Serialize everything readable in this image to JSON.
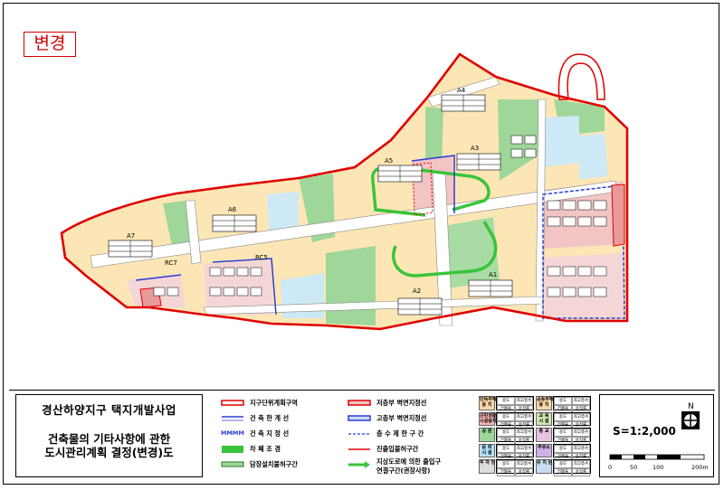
{
  "badge": "변경",
  "title_box": {
    "line1": "경산하양지구 택지개발사업",
    "line2": "건축물의 기타사항에 관한",
    "line3": "도시관리계획 결정(변경)도"
  },
  "blocks": {
    "a1": "A1",
    "a2": "A2",
    "a3": "A3",
    "a4": "A4",
    "a5": "A5",
    "a6": "A6",
    "a7": "A7",
    "rc5": "RC5",
    "rc7": "RC7"
  },
  "legend": {
    "col1": [
      "지구단위계획구역",
      "건 축 한 계 선",
      "건 축 지 정 선",
      "차 폐 조 경",
      "담장설치불허구간"
    ],
    "col2": [
      "저층부 벽면지정선",
      "고층부 벽면지정선",
      "층 수 제 한 구 간",
      "진출입불허구간",
      "지상도로에 의한 출입구",
      "연결구간(권장사항)"
    ],
    "mmm_label": "MMMM",
    "zones": [
      {
        "name": "단독주택\n용 지",
        "color": "#ffd8a8"
      },
      {
        "name": "공동주택\n용 지",
        "color": "#ffd8a8"
      },
      {
        "name": "근린생활\n시설용지",
        "color": "#f7b8b8"
      },
      {
        "name": "교 육\n시 설",
        "color": "#cfe8b0"
      },
      {
        "name": "공 원",
        "color": "#9fd69a"
      },
      {
        "name": "종 교",
        "color": "#e8c3e0"
      },
      {
        "name": "문 화\n시 설",
        "color": "#b5e0f5"
      },
      {
        "name": "주유소",
        "color": "#ccb3e8"
      },
      {
        "name": "주 차 장",
        "color": "#dcdcdc"
      },
      {
        "name": "유 치 원",
        "color": "#c8ddf2"
      }
    ],
    "zone_cell": [
      "용도",
      "최고층수",
      "건폐율",
      "용적률"
    ]
  },
  "scale": {
    "text": "S=1:2,000",
    "north": "N",
    "ticks": [
      "0",
      "50",
      "100",
      "200m"
    ]
  },
  "colors": {
    "boundary": "#e00000",
    "road": "#ffffff",
    "park": "#9fd69a",
    "residential": "#fce6b6",
    "school": "#cde9f5",
    "commercial": "#f2c4c4",
    "building_line": "#2b3dd6",
    "planting": "#3ac43a"
  }
}
